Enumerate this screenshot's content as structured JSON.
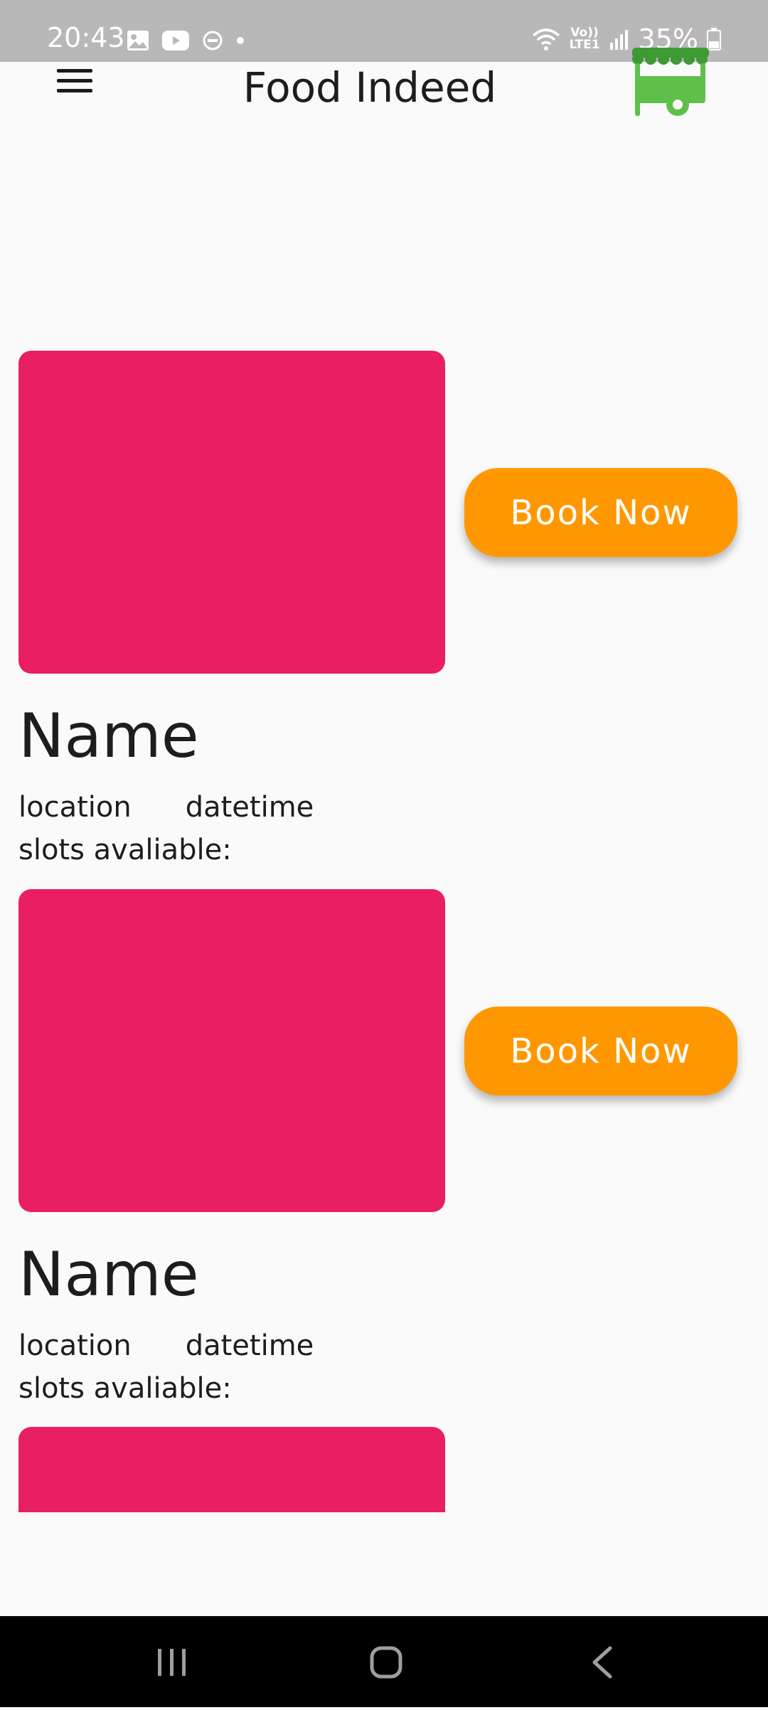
{
  "status_bar": {
    "time": "20:43",
    "lte_top": "Vo))",
    "lte_bottom": "LTE1",
    "battery": "35%"
  },
  "app_bar": {
    "title": "Food Indeed",
    "menu_icon": "hamburger-menu-icon",
    "logo_icon": "food-cart-icon"
  },
  "events": [
    {
      "name": "Name",
      "location": "location",
      "datetime": "datetime",
      "slots": "slots avaliable:",
      "button": "Book Now"
    },
    {
      "name": "Name",
      "location": "location",
      "datetime": "datetime",
      "slots": "slots avaliable:",
      "button": "Book Now"
    }
  ],
  "colors": {
    "card_image": "#e91e63",
    "book_button": "#ff9800",
    "logo_green": "#5ec04a",
    "status_bar": "#b8b8b8",
    "nav_bar": "#000000"
  },
  "nav_bar": {
    "recents_icon": "recents-icon",
    "home_icon": "home-icon",
    "back_icon": "back-icon"
  }
}
